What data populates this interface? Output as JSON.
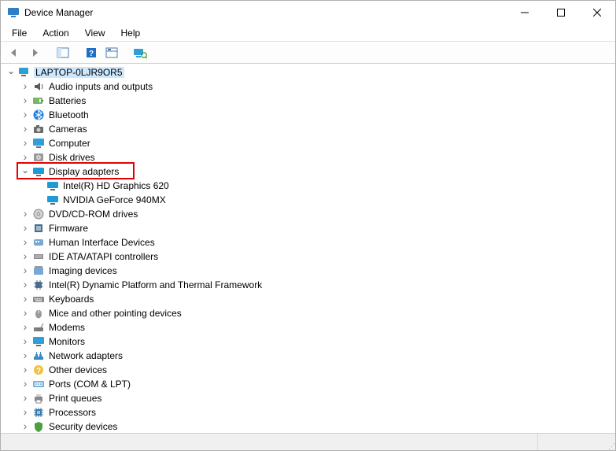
{
  "window": {
    "title": "Device Manager"
  },
  "menu": {
    "file": "File",
    "action": "Action",
    "view": "View",
    "help": "Help"
  },
  "toolbar": {
    "back": "Back",
    "forward": "Forward",
    "show_hide": "Show/Hide Console Tree",
    "help": "Help",
    "properties": "Properties",
    "scan": "Scan for hardware changes"
  },
  "tree": {
    "root": {
      "label": "LAPTOP-0LJR9OR5",
      "icon": "computer-icon",
      "expanded": true,
      "depth": 0,
      "selected": true
    },
    "nodes": [
      {
        "label": "Audio inputs and outputs",
        "icon": "audio-icon",
        "expanded": false,
        "depth": 1
      },
      {
        "label": "Batteries",
        "icon": "battery-icon",
        "expanded": false,
        "depth": 1
      },
      {
        "label": "Bluetooth",
        "icon": "bluetooth-icon",
        "expanded": false,
        "depth": 1
      },
      {
        "label": "Cameras",
        "icon": "camera-icon",
        "expanded": false,
        "depth": 1
      },
      {
        "label": "Computer",
        "icon": "monitor-icon",
        "expanded": false,
        "depth": 1
      },
      {
        "label": "Disk drives",
        "icon": "disk-icon",
        "expanded": false,
        "depth": 1
      },
      {
        "label": "Display adapters",
        "icon": "display-icon",
        "expanded": true,
        "depth": 1,
        "highlighted": true
      },
      {
        "label": "Intel(R) HD Graphics 620",
        "icon": "display-icon",
        "expanded": null,
        "depth": 2
      },
      {
        "label": "NVIDIA GeForce 940MX",
        "icon": "display-icon",
        "expanded": null,
        "depth": 2
      },
      {
        "label": "DVD/CD-ROM drives",
        "icon": "optical-icon",
        "expanded": false,
        "depth": 1
      },
      {
        "label": "Firmware",
        "icon": "firmware-icon",
        "expanded": false,
        "depth": 1
      },
      {
        "label": "Human Interface Devices",
        "icon": "hid-icon",
        "expanded": false,
        "depth": 1
      },
      {
        "label": "IDE ATA/ATAPI controllers",
        "icon": "ide-icon",
        "expanded": false,
        "depth": 1
      },
      {
        "label": "Imaging devices",
        "icon": "imaging-icon",
        "expanded": false,
        "depth": 1
      },
      {
        "label": "Intel(R) Dynamic Platform and Thermal Framework",
        "icon": "chip-icon",
        "expanded": false,
        "depth": 1
      },
      {
        "label": "Keyboards",
        "icon": "keyboard-icon",
        "expanded": false,
        "depth": 1
      },
      {
        "label": "Mice and other pointing devices",
        "icon": "mouse-icon",
        "expanded": false,
        "depth": 1
      },
      {
        "label": "Modems",
        "icon": "modem-icon",
        "expanded": false,
        "depth": 1
      },
      {
        "label": "Monitors",
        "icon": "monitor-icon",
        "expanded": false,
        "depth": 1
      },
      {
        "label": "Network adapters",
        "icon": "network-icon",
        "expanded": false,
        "depth": 1
      },
      {
        "label": "Other devices",
        "icon": "other-icon",
        "expanded": false,
        "depth": 1
      },
      {
        "label": "Ports (COM & LPT)",
        "icon": "port-icon",
        "expanded": false,
        "depth": 1
      },
      {
        "label": "Print queues",
        "icon": "printer-icon",
        "expanded": false,
        "depth": 1
      },
      {
        "label": "Processors",
        "icon": "processor-icon",
        "expanded": false,
        "depth": 1
      },
      {
        "label": "Security devices",
        "icon": "security-icon",
        "expanded": false,
        "depth": 1
      }
    ]
  },
  "colors": {
    "highlight_border": "#e60000",
    "selection_bg": "#cce8ff"
  }
}
